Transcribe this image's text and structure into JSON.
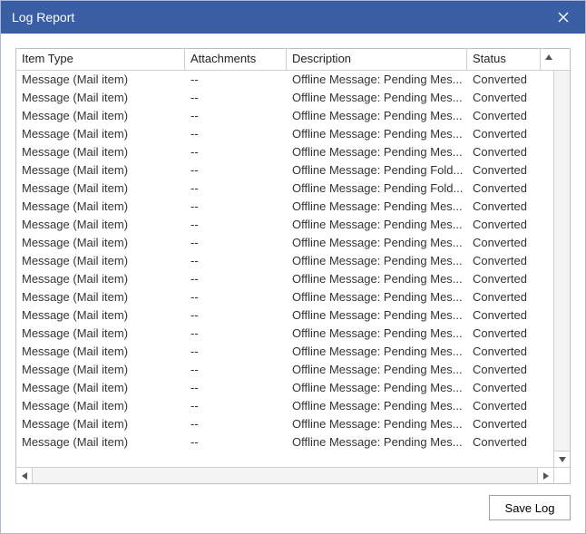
{
  "window": {
    "title": "Log Report"
  },
  "columns": {
    "item_type": "Item Type",
    "attachments": "Attachments",
    "description": "Description",
    "status": "Status"
  },
  "rows": [
    {
      "item_type": "Message (Mail item)",
      "attachments": "--",
      "description": "Offline Message: Pending Mes...",
      "status": "Converted"
    },
    {
      "item_type": "Message (Mail item)",
      "attachments": "--",
      "description": "Offline Message: Pending Mes...",
      "status": "Converted"
    },
    {
      "item_type": "Message (Mail item)",
      "attachments": "--",
      "description": "Offline Message: Pending Mes...",
      "status": "Converted"
    },
    {
      "item_type": "Message (Mail item)",
      "attachments": "--",
      "description": "Offline Message: Pending Mes...",
      "status": "Converted"
    },
    {
      "item_type": "Message (Mail item)",
      "attachments": "--",
      "description": "Offline Message: Pending Mes...",
      "status": "Converted"
    },
    {
      "item_type": "Message (Mail item)",
      "attachments": "--",
      "description": "Offline Message: Pending Fold...",
      "status": "Converted"
    },
    {
      "item_type": "Message (Mail item)",
      "attachments": "--",
      "description": "Offline Message: Pending Fold...",
      "status": "Converted"
    },
    {
      "item_type": "Message (Mail item)",
      "attachments": "--",
      "description": "Offline Message: Pending Mes...",
      "status": "Converted"
    },
    {
      "item_type": "Message (Mail item)",
      "attachments": "--",
      "description": "Offline Message: Pending Mes...",
      "status": "Converted"
    },
    {
      "item_type": "Message (Mail item)",
      "attachments": "--",
      "description": "Offline Message: Pending Mes...",
      "status": "Converted"
    },
    {
      "item_type": "Message (Mail item)",
      "attachments": "--",
      "description": "Offline Message: Pending Mes...",
      "status": "Converted"
    },
    {
      "item_type": "Message (Mail item)",
      "attachments": "--",
      "description": "Offline Message: Pending Mes...",
      "status": "Converted"
    },
    {
      "item_type": "Message (Mail item)",
      "attachments": "--",
      "description": "Offline Message: Pending Mes...",
      "status": "Converted"
    },
    {
      "item_type": "Message (Mail item)",
      "attachments": "--",
      "description": "Offline Message: Pending Mes...",
      "status": "Converted"
    },
    {
      "item_type": "Message (Mail item)",
      "attachments": "--",
      "description": "Offline Message: Pending Mes...",
      "status": "Converted"
    },
    {
      "item_type": "Message (Mail item)",
      "attachments": "--",
      "description": "Offline Message: Pending Mes...",
      "status": "Converted"
    },
    {
      "item_type": "Message (Mail item)",
      "attachments": "--",
      "description": "Offline Message: Pending Mes...",
      "status": "Converted"
    },
    {
      "item_type": "Message (Mail item)",
      "attachments": "--",
      "description": "Offline Message: Pending Mes...",
      "status": "Converted"
    },
    {
      "item_type": "Message (Mail item)",
      "attachments": "--",
      "description": "Offline Message: Pending Mes...",
      "status": "Converted"
    },
    {
      "item_type": "Message (Mail item)",
      "attachments": "--",
      "description": "Offline Message: Pending Mes...",
      "status": "Converted"
    },
    {
      "item_type": "Message (Mail item)",
      "attachments": "--",
      "description": "Offline Message: Pending Mes...",
      "status": "Converted"
    }
  ],
  "buttons": {
    "save_log": "Save Log"
  }
}
